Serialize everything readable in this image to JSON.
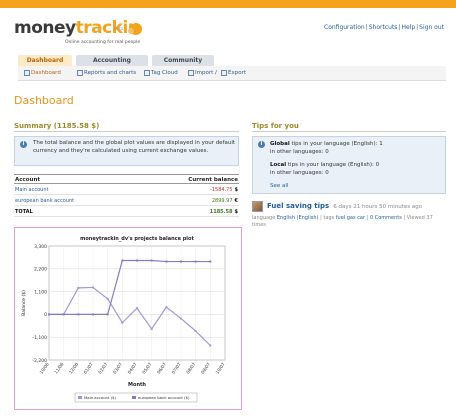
{
  "header": {
    "logo_money": "money",
    "logo_trackin": "trackin",
    "logo_beta": "beta",
    "tagline": "Online accounting for real people",
    "links": [
      "Configuration",
      "Shortcuts",
      "Help",
      "Sign out"
    ]
  },
  "tabs": [
    {
      "label": "Dashboard",
      "active": true
    },
    {
      "label": "Accounting",
      "active": false
    },
    {
      "label": "Community",
      "active": false
    }
  ],
  "subnav": [
    {
      "label": "Dashboard",
      "icon": "dashboard-icon"
    },
    {
      "label": "Reports and charts",
      "icon": "report-icon"
    },
    {
      "label": "Tag Cloud",
      "icon": "tag-icon"
    },
    {
      "label": "Import /",
      "icon": "import-icon"
    },
    {
      "label": "Export",
      "icon": "export-icon"
    }
  ],
  "page_title": "Dashboard",
  "summary": {
    "title": "Summary (1185.58 $)",
    "info": "The total balance and the global plot values are displayed in your default currency and they're calculated using current exchange values.",
    "col_account": "Account",
    "col_balance": "Current balance",
    "rows": [
      {
        "name": "Main account",
        "balance": "-1584.75",
        "currency": "$"
      },
      {
        "name": "european bank account",
        "balance": "2899.97",
        "currency": "€"
      }
    ],
    "total_label": "TOTAL",
    "total_value": "1185.58",
    "total_currency": "$"
  },
  "tips": {
    "title": "Tips for you",
    "global_label": "Global",
    "global_text": " tips in your language (English): 1",
    "global_other": "in other languages: 0",
    "local_label": "Local",
    "local_text": " tips in your language (English): 0",
    "local_other": "in other languages: 0",
    "see_all": "See all",
    "entry_title": "Fuel saving tips",
    "entry_age": "6 days 21 hours 50 minutes ago",
    "meta_language_label": "language",
    "meta_language": "English (English)",
    "meta_tags_label": "tags",
    "meta_tags": "fuel gas car",
    "meta_comments": "0 Comments",
    "meta_viewed": "Viewed 37 times"
  },
  "chart_data": {
    "type": "line",
    "title": "moneytrackin_dv's projects balance plot",
    "xlabel": "Month",
    "ylabel": "Balance ($)",
    "ylim": [
      -2200,
      3300
    ],
    "yticks": [
      -2200,
      -1100,
      0,
      1100,
      2200,
      3300
    ],
    "ytick_labels": [
      "-2,200",
      "-1,100",
      "0",
      "1,100",
      "2,200",
      "3,300"
    ],
    "categories": [
      "10/06",
      "11/06",
      "12/06",
      "01/07",
      "02/07",
      "03/07",
      "04/07",
      "05/07",
      "06/07",
      "07/07",
      "08/07",
      "09/07",
      "10/07"
    ],
    "series": [
      {
        "name": "Main account ($)",
        "color": "#a596d6",
        "values": [
          0,
          0,
          1280,
          1300,
          750,
          -400,
          300,
          -700,
          350,
          -200,
          -800,
          -1500,
          null
        ]
      },
      {
        "name": "european bank account ($)",
        "color": "#8a79c9",
        "values": [
          0,
          0,
          0,
          0,
          0,
          2600,
          2600,
          2600,
          2550,
          2550,
          2550,
          2550,
          null
        ]
      }
    ],
    "grid": true,
    "legend": "bottom"
  }
}
